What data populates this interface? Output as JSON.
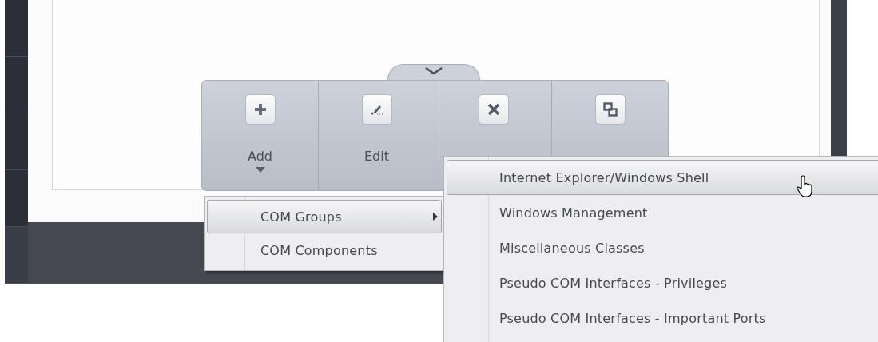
{
  "toolbar": {
    "buttons": [
      {
        "kind": "plus",
        "label": "Add",
        "has_menu": true
      },
      {
        "kind": "pen",
        "label": "Edit",
        "has_menu": false
      },
      {
        "kind": "cross",
        "has_menu": false
      },
      {
        "kind": "group",
        "has_menu": false
      }
    ]
  },
  "menu": {
    "items": [
      {
        "label": "COM Groups",
        "selected": true,
        "has_submenu": true
      },
      {
        "label": "COM Components",
        "selected": false,
        "has_submenu": false
      }
    ]
  },
  "submenu": {
    "items": [
      {
        "label": "Internet Explorer/Windows Shell",
        "selected": true
      },
      {
        "label": "Windows Management",
        "selected": false
      },
      {
        "label": "Miscellaneous Classes",
        "selected": false
      },
      {
        "label": "Pseudo COM Interfaces - Privileges",
        "selected": false
      },
      {
        "label": "Pseudo COM Interfaces - Important Ports",
        "selected": false
      }
    ]
  }
}
